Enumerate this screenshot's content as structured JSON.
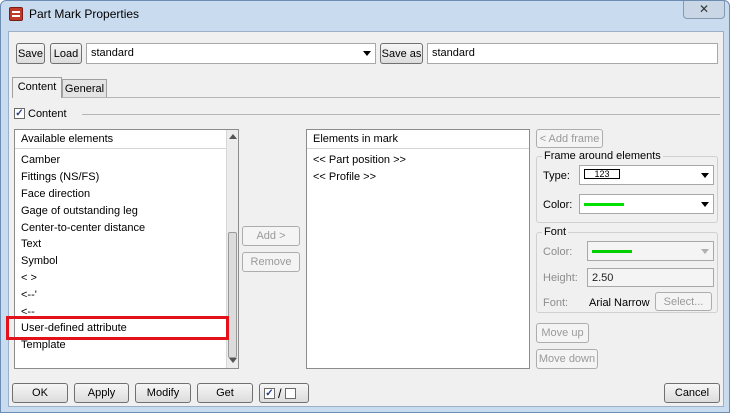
{
  "window": {
    "title": "Part Mark Properties",
    "close_label": "✕"
  },
  "toolbar": {
    "save_label": "Save",
    "load_label": "Load",
    "load_value": "standard",
    "save_as_label": "Save as",
    "save_as_value": "standard"
  },
  "tabs": [
    {
      "label": "Content"
    },
    {
      "label": "General"
    }
  ],
  "content_checkbox": {
    "label": "Content",
    "checked": "✓"
  },
  "available": {
    "header": "Available elements",
    "items": [
      "Camber",
      "Fittings (NS/FS)",
      "Face direction",
      "Gage of outstanding leg",
      "Center-to-center distance",
      "Text",
      "Symbol",
      "<  >",
      "<--'",
      "<--",
      "User-defined attribute",
      "Template"
    ]
  },
  "middle_buttons": {
    "add_label": "Add >",
    "remove_label": "Remove"
  },
  "in_mark": {
    "header": "Elements in mark",
    "items": [
      "<< Part position >>",
      "<< Profile >>"
    ]
  },
  "right": {
    "add_frame_label": "< Add frame",
    "frame_group": "Frame around elements",
    "type_label": "Type:",
    "type_value": "123",
    "color_label": "Color:",
    "frame_color": "#00e000",
    "font_group": "Font",
    "font_color_label": "Color:",
    "font_color": "#00d000",
    "height_label": "Height:",
    "height_value": "2.50",
    "font_label": "Font:",
    "font_value": "Arial Narrow",
    "select_label": "Select...",
    "move_up_label": "Move up",
    "move_down_label": "Move down"
  },
  "bottom": {
    "ok_label": "OK",
    "apply_label": "Apply",
    "modify_label": "Modify",
    "get_label": "Get",
    "toggle_on": "✓",
    "toggle_sep": "/",
    "cancel_label": "Cancel"
  }
}
